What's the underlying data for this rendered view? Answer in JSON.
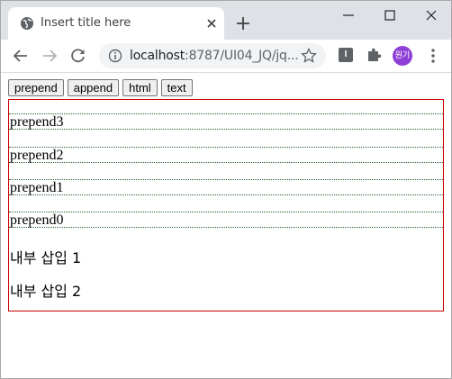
{
  "browser": {
    "tab_title": "Insert title here",
    "url_host": "localhost",
    "url_rest": ":8787/UI04_JQ/jq...",
    "avatar_text": "원기",
    "extension_letter": "I"
  },
  "page": {
    "buttons": [
      "prepend",
      "append",
      "html",
      "text"
    ],
    "prepended": [
      "prepend3",
      "prepend2",
      "prepend1",
      "prepend0"
    ],
    "paragraphs": [
      "내부 삽입 1",
      "내부 삽입 2"
    ]
  },
  "colors": {
    "container_border": "#cc0000",
    "dotted_border": "#2f5f2f",
    "avatar_bg": "#8e3fd6"
  }
}
